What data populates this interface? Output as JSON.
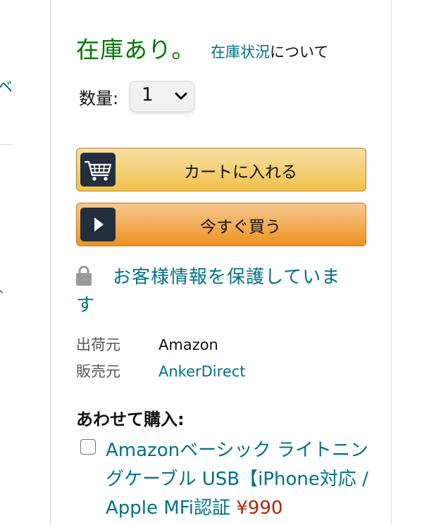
{
  "left_column": {
    "fragment_glyph": "ベ",
    "fragment_mark": "、"
  },
  "buybox": {
    "availability": {
      "status": "在庫あり。",
      "about_link": "在庫状況",
      "about_suffix": "について"
    },
    "quantity": {
      "label": "数量:",
      "selected": "1"
    },
    "add_to_cart": {
      "label": "カートに入れる",
      "icon": "cart-icon"
    },
    "buy_now": {
      "label": "今すぐ買う",
      "icon": "play-icon"
    },
    "secure": {
      "icon": "lock-icon",
      "text": "お客様情報を保護しています"
    },
    "shipping": {
      "shipper_label": "出荷元",
      "shipper_value": "Amazon",
      "seller_label": "販売元",
      "seller_value": "AnkerDirect"
    },
    "bundle": {
      "title": "あわせて購入:",
      "item_title": "Amazonベーシック ライトニングケーブル USB【iPhone対応 / Apple MFi認証",
      "item_price": "¥990"
    }
  },
  "colors": {
    "in_stock_green": "#007600",
    "link_teal": "#007185",
    "cart_button": "#f0c14b",
    "buy_now_button": "#ed9220",
    "icon_tile": "#232f3e",
    "price_red": "#b12704"
  }
}
